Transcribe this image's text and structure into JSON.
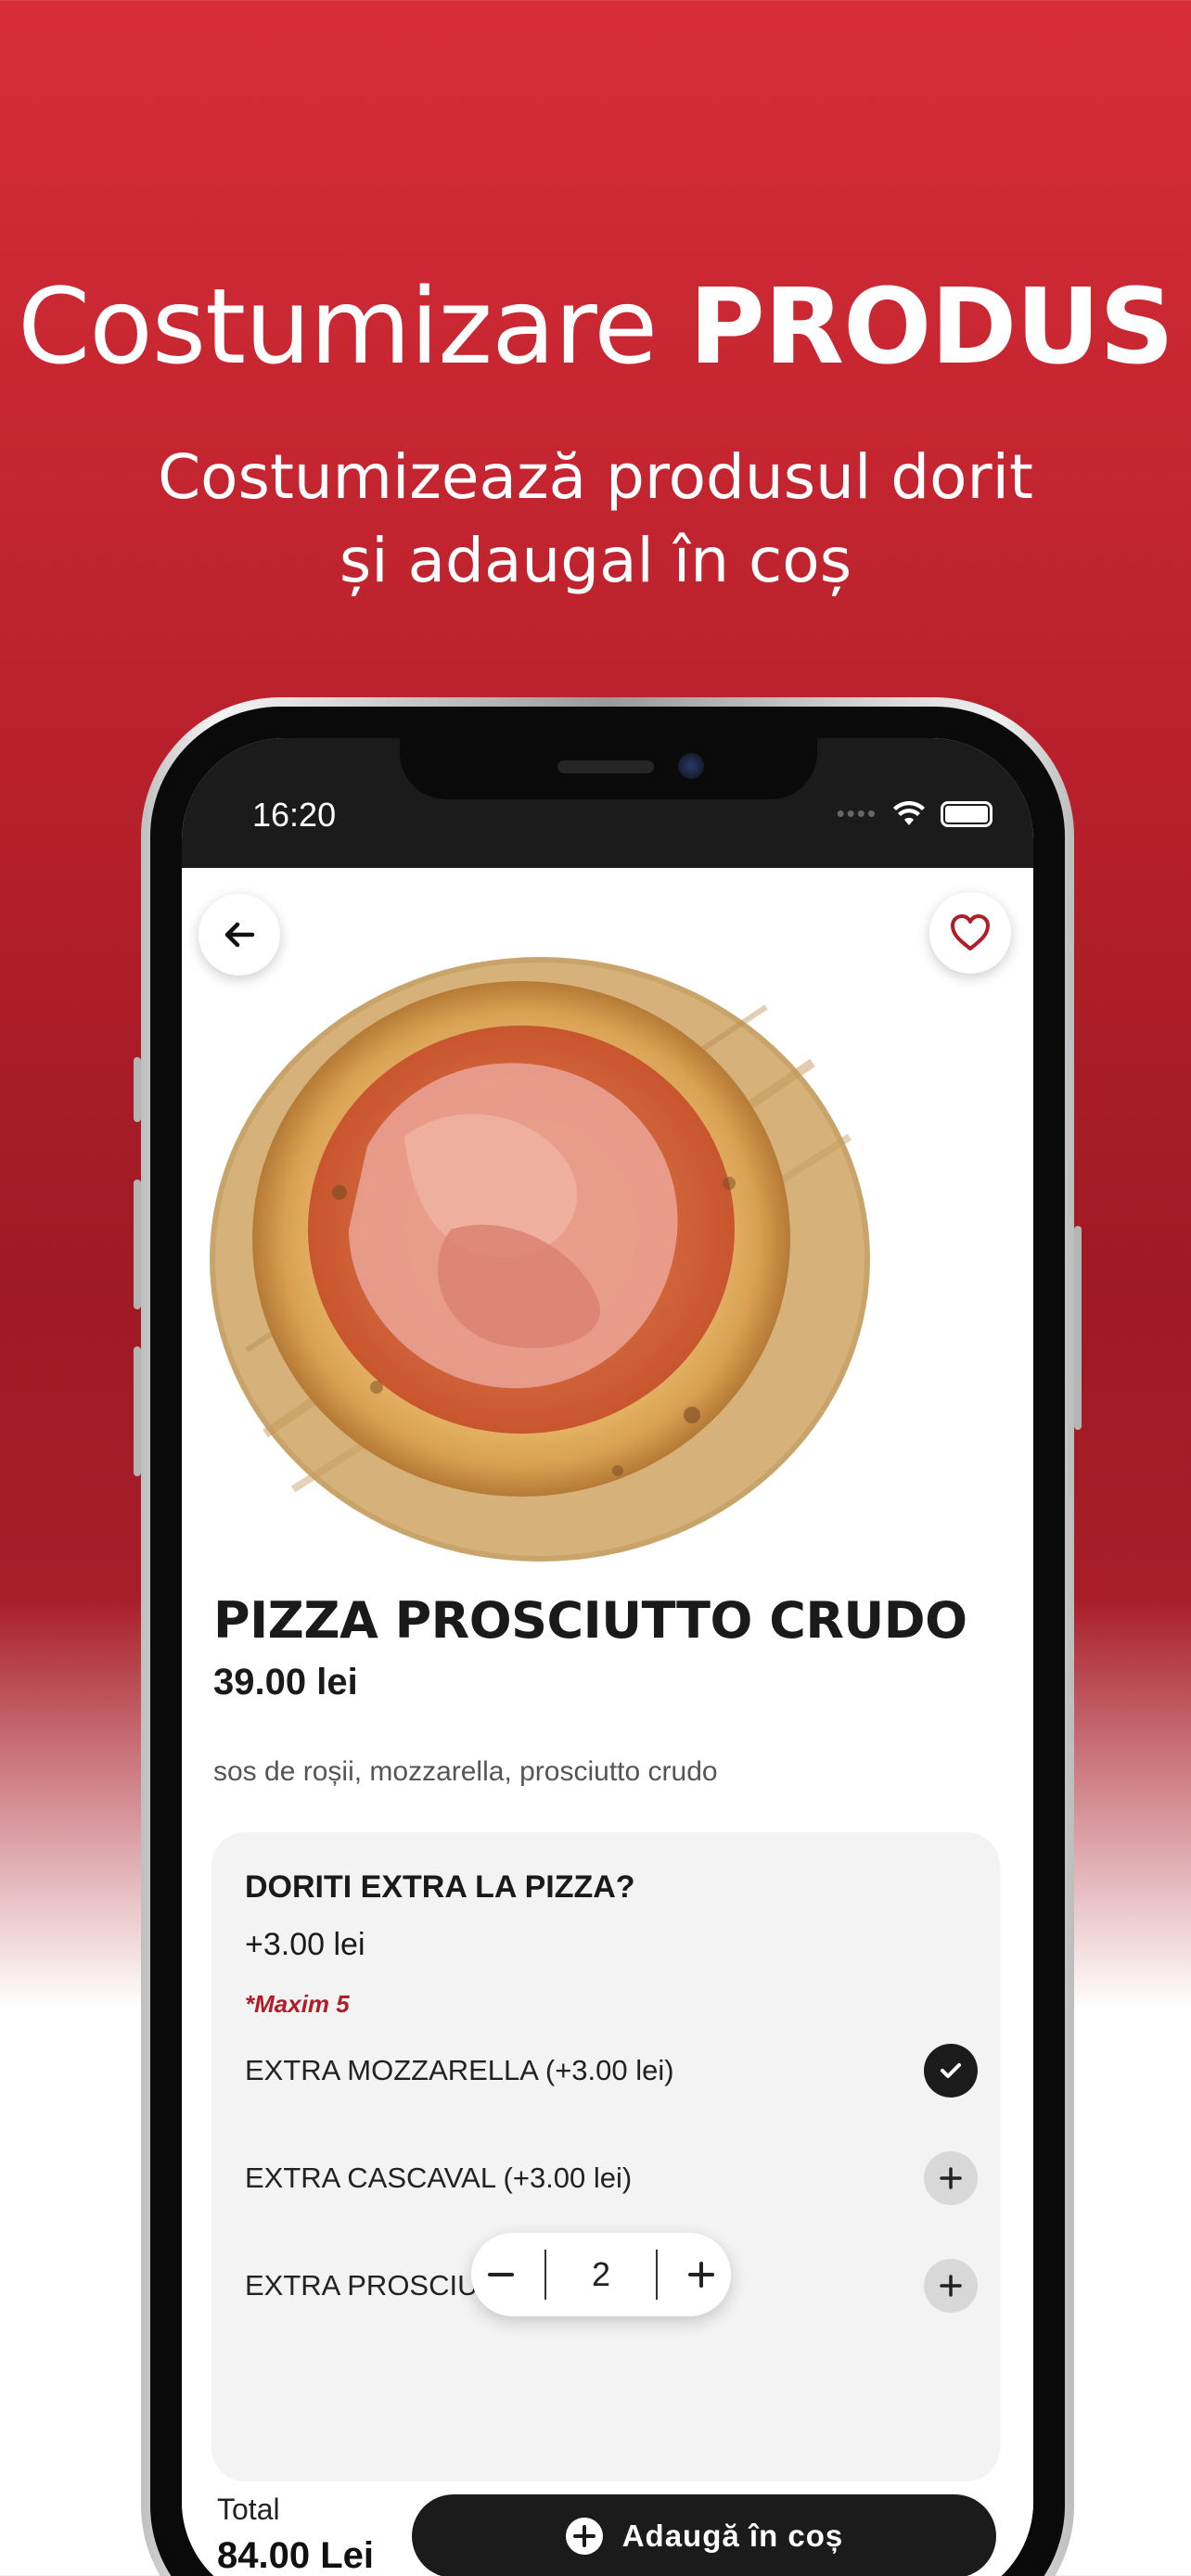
{
  "promo": {
    "title_light": "Costumizare",
    "title_bold": "PRODUS",
    "subtitle_line1": "Costumizează produsul dorit",
    "subtitle_line2": "și adaugal în coș"
  },
  "status_bar": {
    "time": "16:20"
  },
  "product": {
    "name": "PIZZA PROSCIUTTO CRUDO",
    "price": "39.00 lei",
    "description": "sos de roșii, mozzarella, prosciutto crudo"
  },
  "extras": {
    "title": "DORITI EXTRA LA PIZZA?",
    "price": "+3.00 lei",
    "max_note": "*Maxim 5",
    "items": [
      {
        "label": "EXTRA MOZZARELLA (+3.00 lei)",
        "selected": true
      },
      {
        "label": "EXTRA CASCAVAL (+3.00 lei)",
        "selected": false
      },
      {
        "label": "EXTRA PROSCIU",
        "selected": false
      }
    ]
  },
  "quantity": {
    "value": "2"
  },
  "footer": {
    "total_label": "Total",
    "total_value": "84.00 Lei",
    "add_button": "Adaugă în coș"
  },
  "colors": {
    "accent": "#b01c28",
    "dark": "#1b1b1b",
    "card": "#f3f3f3"
  }
}
